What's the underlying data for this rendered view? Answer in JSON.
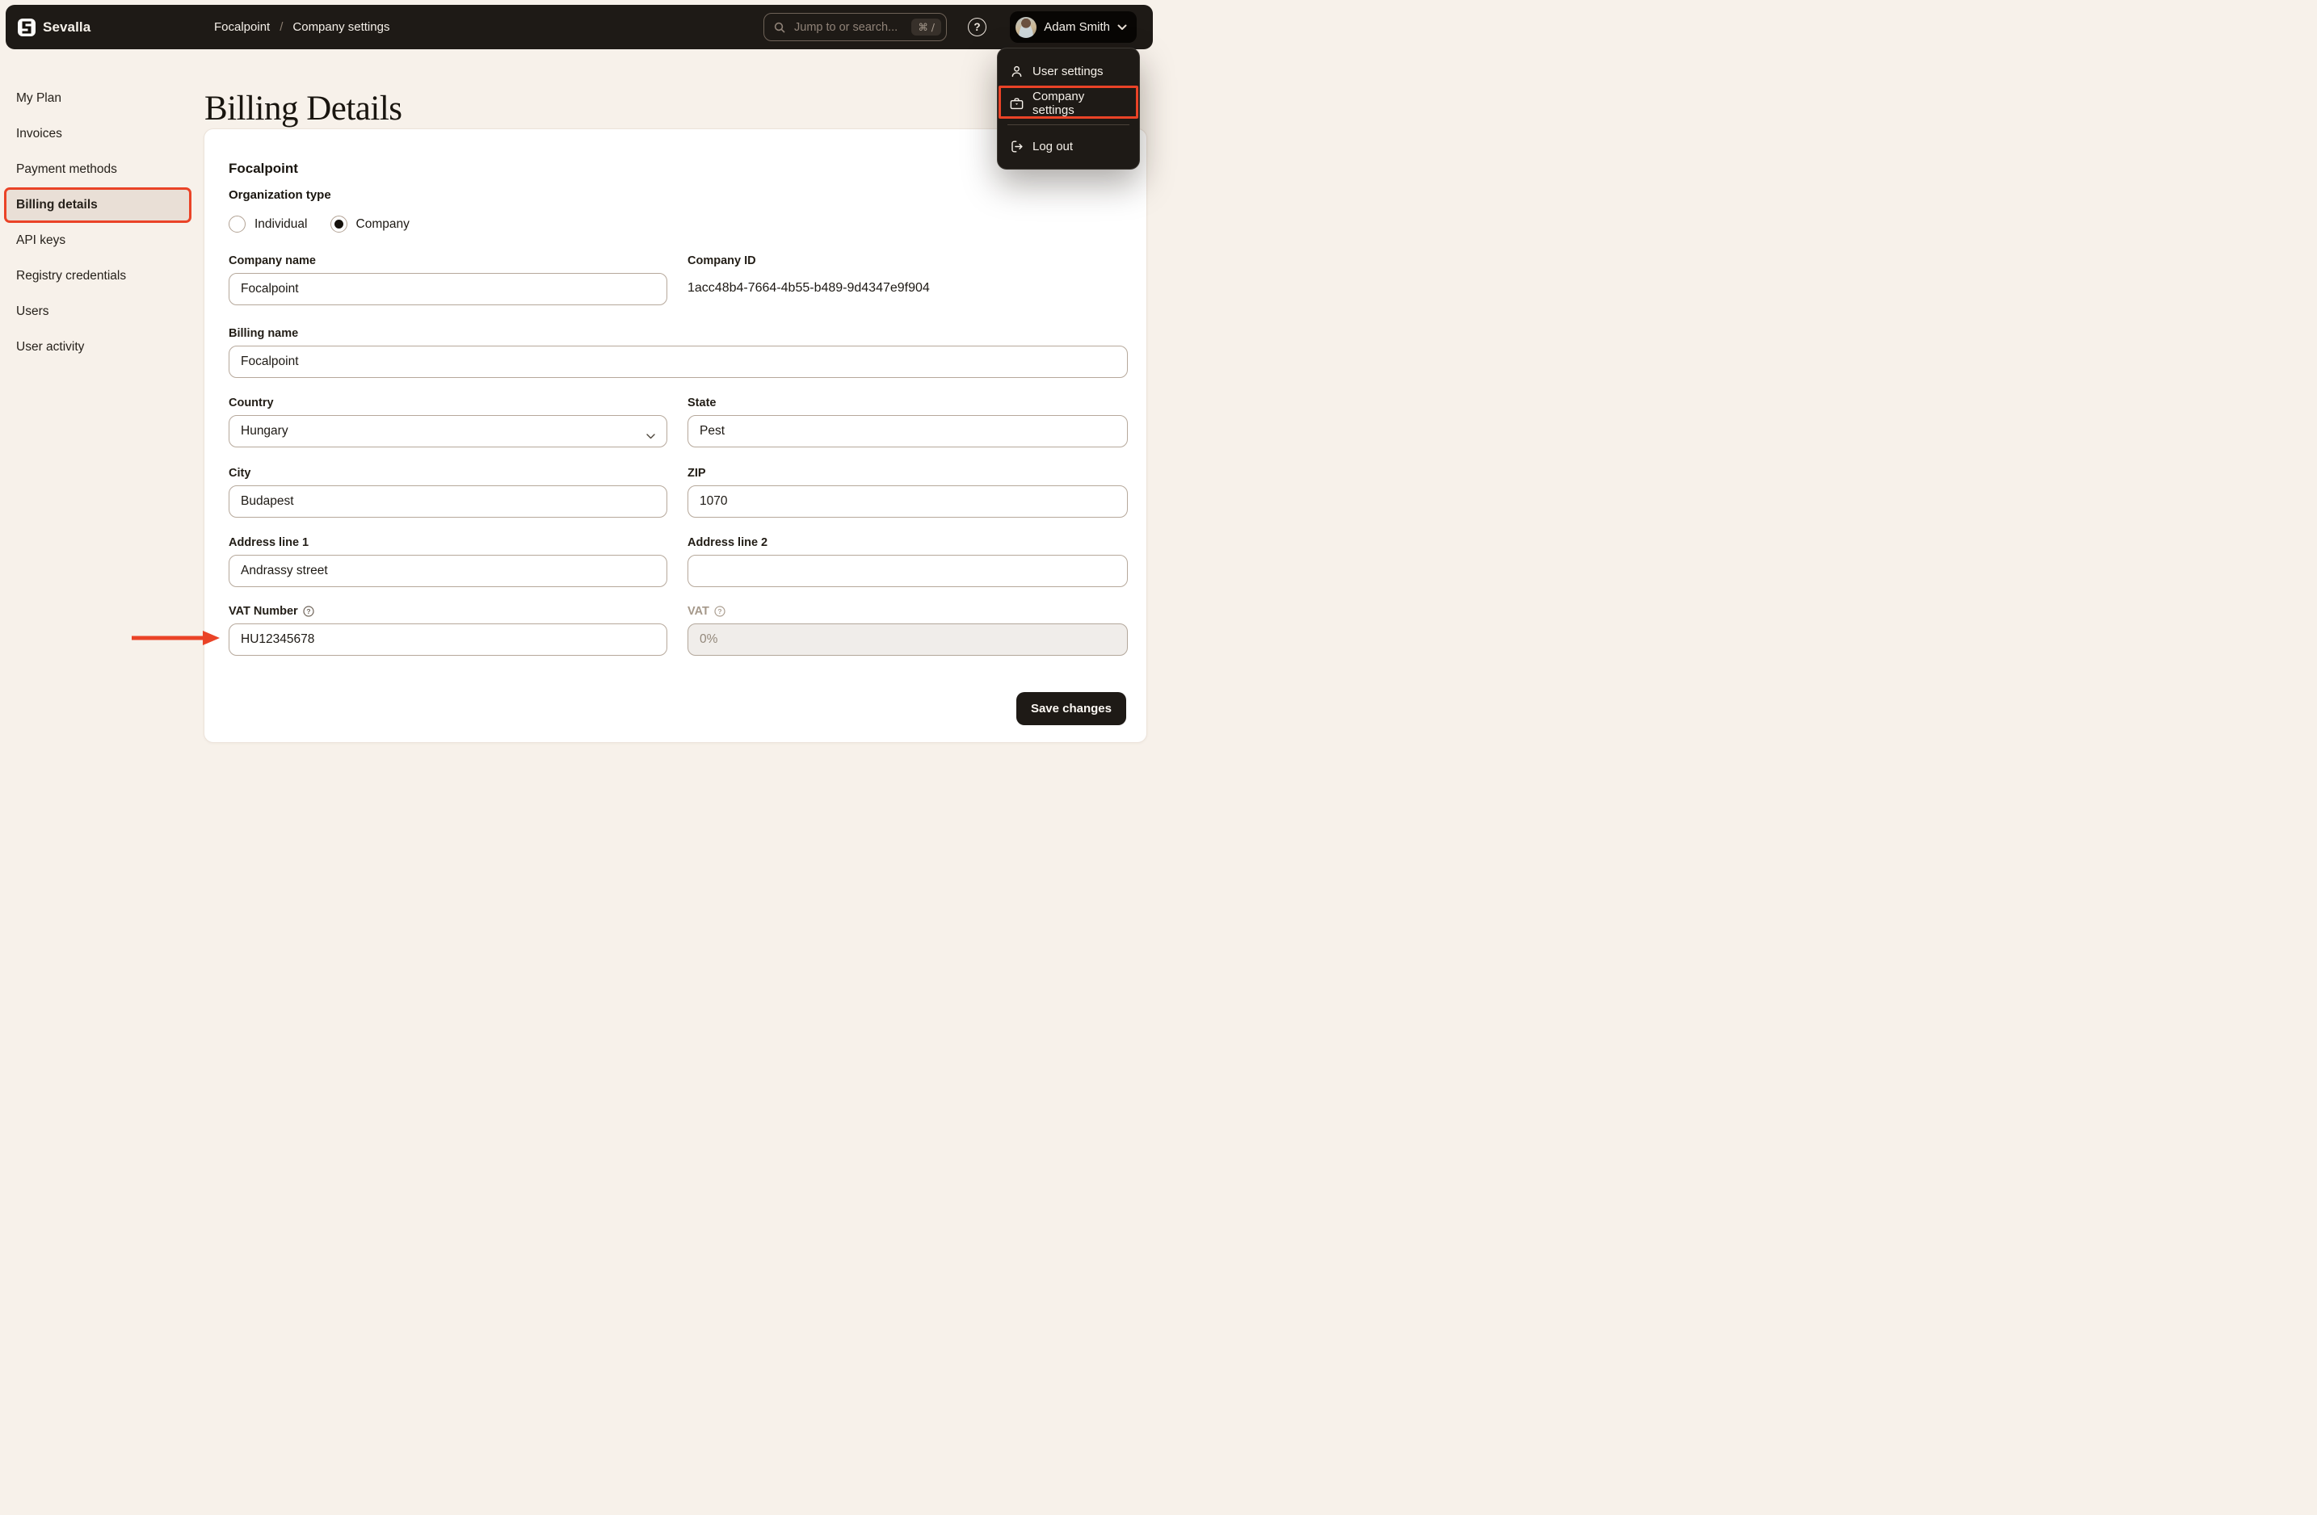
{
  "colors": {
    "annotation_red": "#ea4327",
    "topbar_bg": "#1e1a16",
    "page_bg": "#f7f1ea",
    "active_item_bg": "#e9dfd6",
    "input_border": "#b6a89b"
  },
  "topbar": {
    "brand": "Sevalla",
    "breadcrumb": {
      "project": "Focalpoint",
      "separator": "/",
      "page": "Company settings"
    },
    "search": {
      "placeholder": "Jump to or search...",
      "shortcut": "⌘ /"
    },
    "user": {
      "name": "Adam Smith"
    }
  },
  "user_menu": {
    "items": [
      {
        "label": "User settings",
        "icon": "user-icon"
      },
      {
        "label": "Company settings",
        "icon": "briefcase-icon"
      },
      {
        "label": "Log out",
        "icon": "logout-icon"
      }
    ]
  },
  "sidebar": {
    "items": [
      {
        "label": "My Plan"
      },
      {
        "label": "Invoices"
      },
      {
        "label": "Payment methods"
      },
      {
        "label": "Billing details",
        "active": true
      },
      {
        "label": "API keys"
      },
      {
        "label": "Registry credentials"
      },
      {
        "label": "Users"
      },
      {
        "label": "User activity"
      }
    ]
  },
  "main": {
    "title": "Billing Details"
  },
  "card": {
    "company_heading": "Focalpoint",
    "organization_type": {
      "label": "Organization type",
      "options": [
        {
          "label": "Individual",
          "selected": false
        },
        {
          "label": "Company",
          "selected": true
        }
      ]
    },
    "fields": {
      "company_name": {
        "label": "Company name",
        "value": "Focalpoint"
      },
      "company_id": {
        "label": "Company ID",
        "value": "1acc48b4-7664-4b55-b489-9d4347e9f904"
      },
      "billing_name": {
        "label": "Billing name",
        "value": "Focalpoint"
      },
      "country": {
        "label": "Country",
        "value": "Hungary"
      },
      "state": {
        "label": "State",
        "value": "Pest"
      },
      "city": {
        "label": "City",
        "value": "Budapest"
      },
      "zip": {
        "label": "ZIP",
        "value": "1070"
      },
      "address1": {
        "label": "Address line 1",
        "value": "Andrassy street"
      },
      "address2": {
        "label": "Address line 2",
        "value": ""
      },
      "vat_number": {
        "label": "VAT Number",
        "value": "HU12345678"
      },
      "vat": {
        "label": "VAT",
        "value": "0%"
      }
    },
    "save_button": "Save changes"
  }
}
